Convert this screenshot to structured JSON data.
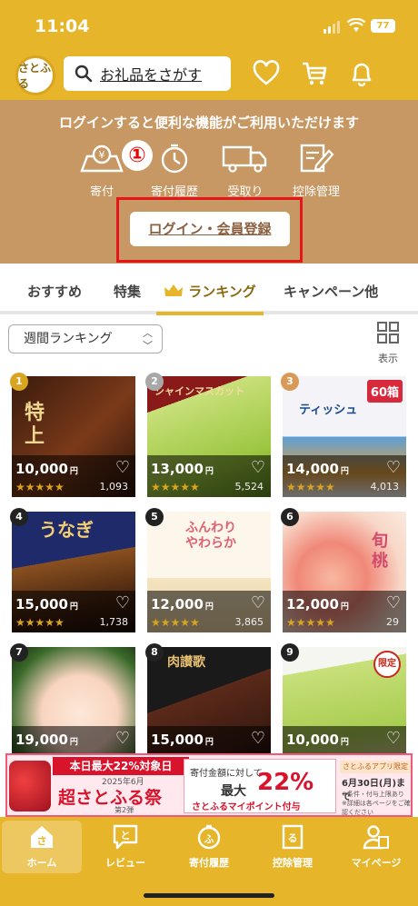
{
  "status_bar": {
    "time": "11:04",
    "battery": "77"
  },
  "header": {
    "logo_text": "さとふる",
    "search_placeholder": "お礼品をさがす"
  },
  "login_banner": {
    "message": "ログインすると便利な機能がご利用いただけます",
    "quick_links": [
      "寄付",
      "寄付履歴",
      "受取り",
      "控除管理"
    ],
    "step_badge": "①",
    "login_button": "ログイン・会員登録"
  },
  "tabs": [
    "おすすめ",
    "特集",
    "ランキング",
    "キャンペーン他"
  ],
  "active_tab": "ランキング",
  "filter": {
    "selected": "週間ランキング",
    "view_label": "表示"
  },
  "products": [
    {
      "rank": "1",
      "price": "10,000",
      "unit": "円",
      "count": "1,093",
      "rating": 4.5,
      "img_label": "特上",
      "rank_color": "#d9a520"
    },
    {
      "rank": "2",
      "price": "13,000",
      "unit": "円",
      "count": "5,524",
      "rating": 4.5,
      "img_label": "シャインマスカット",
      "rank_color": "#a8a8a8"
    },
    {
      "rank": "3",
      "price": "14,000",
      "unit": "円",
      "count": "4,013",
      "rating": 4.5,
      "img_label": "ティッシュ",
      "img_badge": "60箱",
      "rank_color": "#d99a58"
    },
    {
      "rank": "4",
      "price": "15,000",
      "unit": "円",
      "count": "1,738",
      "rating": 4.5,
      "img_label": "うなぎ",
      "rank_color": "#222"
    },
    {
      "rank": "5",
      "price": "12,000",
      "unit": "円",
      "count": "3,865",
      "rating": 4.5,
      "img_label": "ふんわりやわらか",
      "rank_color": "#222"
    },
    {
      "rank": "6",
      "price": "12,000",
      "unit": "円",
      "count": "29",
      "rating": 4.5,
      "img_label": "旬 桃",
      "rank_color": "#222"
    },
    {
      "rank": "7",
      "price": "19,000",
      "unit": "円",
      "count": "",
      "rating": 0,
      "img_label": "",
      "rank_color": "#222"
    },
    {
      "rank": "8",
      "price": "15,000",
      "unit": "円",
      "count": "",
      "rating": 0,
      "img_label": "肉讃歌",
      "rank_color": "#222"
    },
    {
      "rank": "9",
      "price": "10,000",
      "unit": "円",
      "count": "",
      "rating": 0,
      "img_label": "限定",
      "rank_color": "#222"
    }
  ],
  "ad": {
    "headline": "本日最大22%対象日",
    "date_line": "2025年6月",
    "campaign": "超さとふる祭",
    "round": "第2弾",
    "desc1": "寄付金額に対して",
    "desc_max": "最大",
    "percent": "22%",
    "points": "さとふるマイポイント付与",
    "app_only": "さとふるアプリ限定",
    "deadline": "6月30日(月)まで",
    "notes": "※条件・付与上限あり ※詳細は各ページをご確認ください"
  },
  "bottom_nav": [
    "ホーム",
    "レビュー",
    "寄付履歴",
    "控除管理",
    "マイページ"
  ],
  "colors": {
    "brand": "#e6b52a",
    "banner": "#c79863",
    "highlight": "#e8141c"
  }
}
